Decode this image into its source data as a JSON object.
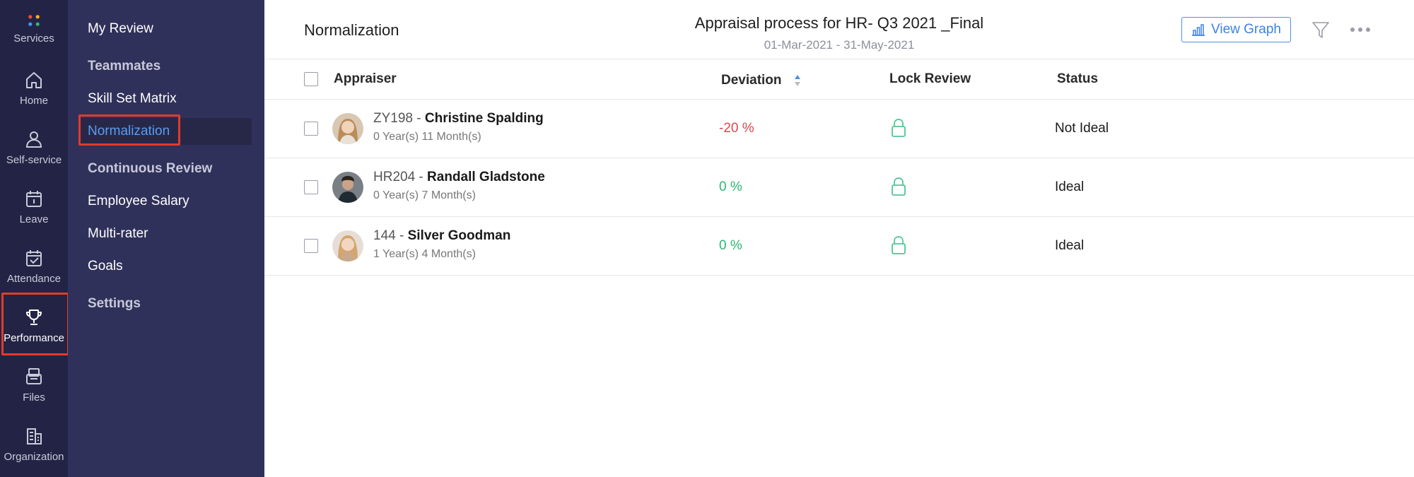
{
  "rail": {
    "items": [
      {
        "label": "Services",
        "icon": "services-icon"
      },
      {
        "label": "Home",
        "icon": "home-icon"
      },
      {
        "label": "Self-service",
        "icon": "user-icon"
      },
      {
        "label": "Leave",
        "icon": "calendar-icon"
      },
      {
        "label": "Attendance",
        "icon": "calendar-check-icon"
      },
      {
        "label": "Performance",
        "icon": "trophy-icon"
      },
      {
        "label": "Files",
        "icon": "files-icon"
      },
      {
        "label": "Organization",
        "icon": "building-icon"
      }
    ],
    "active": "Performance"
  },
  "subnav": {
    "items": [
      {
        "label": "My Review"
      },
      {
        "label": "Teammates"
      },
      {
        "label": "Skill Set Matrix"
      },
      {
        "label": "Normalization"
      },
      {
        "label": "Continuous Review"
      },
      {
        "label": "Employee Salary"
      },
      {
        "label": "Multi-rater"
      },
      {
        "label": "Goals"
      },
      {
        "label": "Settings"
      }
    ],
    "active": "Normalization"
  },
  "header": {
    "page_title": "Normalization",
    "appraisal_title": "Appraisal process for HR- Q3 2021 _Final",
    "appraisal_dates": "01-Mar-2021 - 31-May-2021",
    "view_graph_label": "View Graph"
  },
  "table": {
    "columns": {
      "appraiser": "Appraiser",
      "deviation": "Deviation",
      "lock_review": "Lock Review",
      "status": "Status"
    },
    "rows": [
      {
        "id_prefix": "ZY198 - ",
        "name": "Christine Spalding",
        "experience": "0 Year(s) 11 Month(s)",
        "deviation": "-20 %",
        "status": "Not Ideal"
      },
      {
        "id_prefix": "HR204 - ",
        "name": "Randall Gladstone",
        "experience": "0 Year(s) 7 Month(s)",
        "deviation": "0 %",
        "status": "Ideal"
      },
      {
        "id_prefix": "144 - ",
        "name": "Silver Goodman",
        "experience": "1 Year(s) 4 Month(s)",
        "deviation": "0 %",
        "status": "Ideal"
      }
    ]
  },
  "colors": {
    "rail_bg": "#232445",
    "subnav_bg": "#30315a",
    "accent_blue": "#3f82e2",
    "negative_red": "#e0454f",
    "positive_green": "#2bb673",
    "lock_green": "#4fc795",
    "highlight_red": "#e23b2c"
  }
}
